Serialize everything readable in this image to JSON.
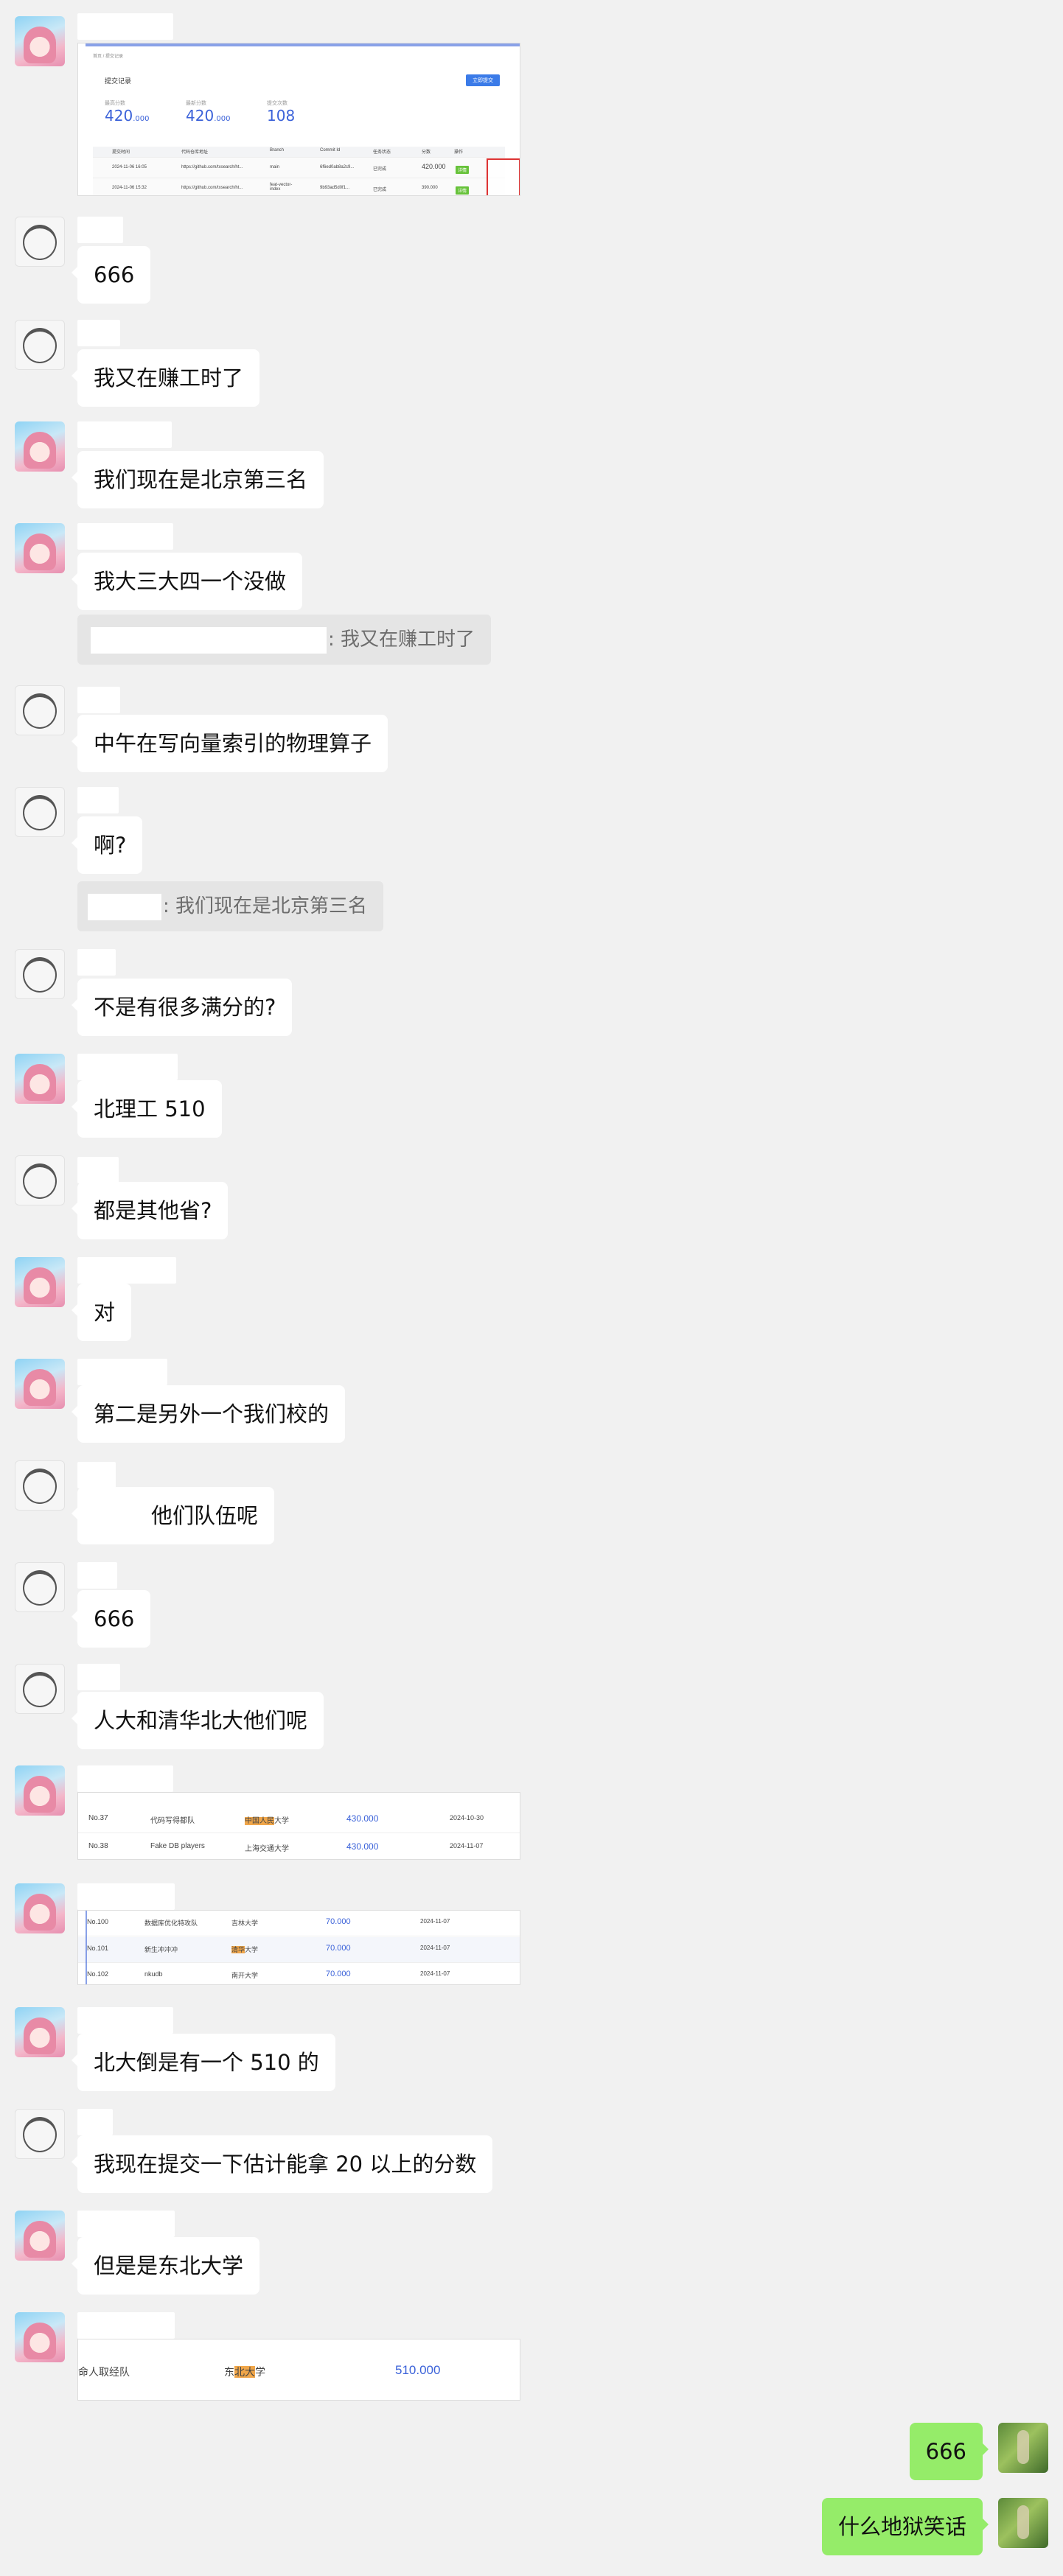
{
  "messages": {
    "m2": "666",
    "m3": "我又在赚工时了",
    "m4": "我们现在是北京第三名",
    "m5": "我大三大四一个没做",
    "m5_quote": ": 我又在赚工时了",
    "m6": "中午在写向量索引的物理算子",
    "m7": "啊?",
    "m7_quote": ": 我们现在是北京第三名",
    "m8": "不是有很多满分的?",
    "m9": "北理工 510",
    "m10": "都是其他省?",
    "m11": "对",
    "m12": "第二是另外一个我们校的",
    "m13": "他们队伍呢",
    "m14": "666",
    "m15": "人大和清华北大他们呢",
    "m18": "北大倒是有一个 510 的",
    "m19": "我现在提交一下估计能拿 20 以上的分数",
    "m20": "但是是东北大学",
    "m22": "666",
    "m23": "什么地狱笑话"
  },
  "screenshot1": {
    "breadcrumb": "首页 / 提交记录",
    "title": "提交记录",
    "button": "立即提交",
    "stats": [
      {
        "label": "最高分数",
        "value": "420",
        "suffix": ".000"
      },
      {
        "label": "最新分数",
        "value": "420",
        "suffix": ".000"
      },
      {
        "label": "提交次数",
        "value": "108",
        "suffix": ""
      }
    ],
    "columns": [
      "提交时间",
      "代码仓库地址",
      "Branch",
      "Commit Id",
      "任务状态",
      "分数",
      "操作"
    ],
    "rows": [
      {
        "time": "2024-11-06 16:05",
        "repo": "https://github.com/txsearch/ht...",
        "branch": "main",
        "commit": "6f6ed0ab8a2c9...",
        "status": "已完成",
        "score": "420.000",
        "op": "详情"
      },
      {
        "time": "2024-11-06 15:32",
        "repo": "https://github.com/txsearch/ht...",
        "branch": "feat-vector-index",
        "commit": "9b93ad5d0f1...",
        "status": "已完成",
        "score": "390.000",
        "op": "详情"
      }
    ]
  },
  "screenshot2": {
    "rows": [
      {
        "rank": "No.37",
        "team": "代码写得都队",
        "school_pre": "",
        "school_hl": "中国人民",
        "school_post": "大学",
        "score": "430.000",
        "date": "2024-10-30"
      },
      {
        "rank": "No.38",
        "team": "Fake DB players",
        "school_pre": "上海交通大学",
        "school_hl": "",
        "school_post": "",
        "score": "430.000",
        "date": "2024-11-07"
      }
    ]
  },
  "screenshot3": {
    "rows": [
      {
        "rank": "No.100",
        "team": "数据库优化特攻队",
        "school": "吉林大学",
        "score": "70.000",
        "date": "2024-11-07"
      },
      {
        "rank": "No.101",
        "team": "新生冲冲冲",
        "school_hl": "清华",
        "school_post": "大学",
        "score": "70.000",
        "date": "2024-11-07"
      },
      {
        "rank": "No.102",
        "team": "nkudb",
        "school": "南开大学",
        "score": "70.000",
        "date": "2024-11-07"
      }
    ]
  },
  "screenshot4": {
    "team": "命人取经队",
    "school_pre": "东",
    "school_hl": "北大",
    "school_post": "学",
    "score": "510.000"
  }
}
